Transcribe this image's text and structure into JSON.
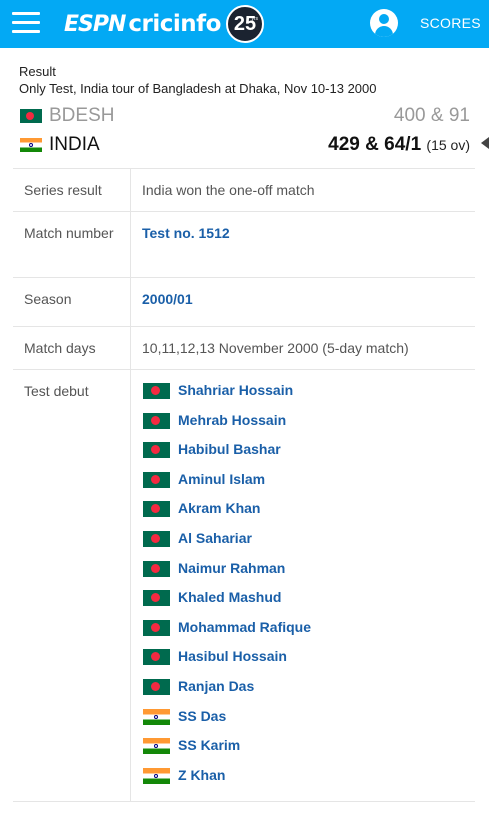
{
  "header": {
    "logo_left": "ESPN",
    "logo_right": "cricinfo",
    "anniversary_badge": "25",
    "anniversary_suffix": "yrs",
    "scores_label": "SCORES",
    "brand_color": "#03a9f4"
  },
  "result": {
    "label": "Result",
    "match_description": "Only Test, India tour of Bangladesh at Dhaka, Nov 10-13 2000",
    "teams": [
      {
        "abbr": "BDESH",
        "score": "400 & 91",
        "overs": "",
        "flag": "bangladesh-flag-icon"
      },
      {
        "abbr": "INDIA",
        "score": "429 & 64/1",
        "overs": "(15 ov)",
        "flag": "india-flag-icon"
      }
    ]
  },
  "details": {
    "series_result": {
      "label": "Series result",
      "value": "India won the one-off match"
    },
    "match_number": {
      "label": "Match number",
      "value": "Test no. 1512"
    },
    "season": {
      "label": "Season",
      "value": "2000/01"
    },
    "match_days": {
      "label": "Match days",
      "value": "10,11,12,13 November 2000 (5-day match)"
    },
    "test_debut": {
      "label": "Test debut",
      "players": [
        {
          "name": "Shahriar Hossain",
          "flag": "bangladesh-flag-icon"
        },
        {
          "name": "Mehrab Hossain",
          "flag": "bangladesh-flag-icon"
        },
        {
          "name": "Habibul Bashar",
          "flag": "bangladesh-flag-icon"
        },
        {
          "name": "Aminul Islam",
          "flag": "bangladesh-flag-icon"
        },
        {
          "name": "Akram Khan",
          "flag": "bangladesh-flag-icon"
        },
        {
          "name": "Al Sahariar",
          "flag": "bangladesh-flag-icon"
        },
        {
          "name": "Naimur Rahman",
          "flag": "bangladesh-flag-icon"
        },
        {
          "name": "Khaled Mashud",
          "flag": "bangladesh-flag-icon"
        },
        {
          "name": "Mohammad Rafique",
          "flag": "bangladesh-flag-icon"
        },
        {
          "name": "Hasibul Hossain",
          "flag": "bangladesh-flag-icon"
        },
        {
          "name": "Ranjan Das",
          "flag": "bangladesh-flag-icon"
        },
        {
          "name": "SS Das",
          "flag": "india-flag-icon"
        },
        {
          "name": "SS Karim",
          "flag": "india-flag-icon"
        },
        {
          "name": "Z Khan",
          "flag": "india-flag-icon"
        }
      ]
    }
  }
}
